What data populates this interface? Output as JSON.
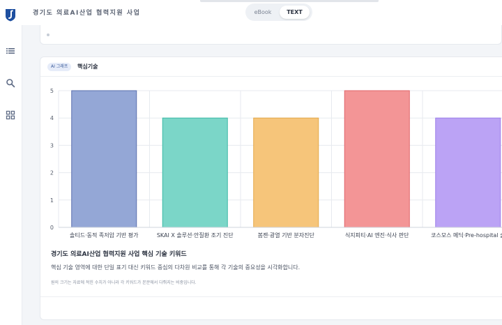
{
  "header": {
    "title": "경기도 의료AI산업 협력지원 사업",
    "toggle": {
      "ebook_label": "eBook",
      "text_label": "TEXT"
    }
  },
  "sidebar": {
    "items": [
      {
        "icon": "list-icon"
      },
      {
        "icon": "search-icon"
      },
      {
        "icon": "grid-icon"
      }
    ]
  },
  "card": {
    "badge": "AI 그래프",
    "title": "핵심기술",
    "caption_title": "경기도 의료AI산업 협력지원 사업 핵심 기술 키워드",
    "caption_desc": "핵심 기술 영역에 대한 단일 표기 대신 키워드 중심의 다차원 비교를 통해 각 기술의 중요성을 시각화합니다.",
    "caption_note": "원의 크기는 자료에 적힌 수치가 아니라 각 키워드가 본문에서 다뤄지는 비중입니다."
  },
  "colors": {
    "accent": "#1e4fa0",
    "bars_fill": [
      "#94a7d6",
      "#7bd6c8",
      "#f6c57a",
      "#f39596",
      "#bba3f5"
    ],
    "bars_stroke": [
      "#5a6fae",
      "#3cb9a6",
      "#e3a849",
      "#e0656a",
      "#9c7ee8"
    ]
  },
  "chart_data": {
    "type": "bar",
    "categories": [
      "솔티드·동적 족저압 기반 평가",
      "SKAI X 솔루션·안질환 조기 진단",
      "봄젠·광열 기반 분자진단",
      "식지피티·AI 엔진·식사 판단",
      "코스모스 메딕·Pre-hospital 솔"
    ],
    "values": [
      5,
      4,
      4,
      5,
      4
    ],
    "ylim": [
      0,
      5
    ],
    "yticks": [
      0,
      1,
      2,
      3,
      4,
      5
    ],
    "grid": true,
    "legend": "none"
  }
}
